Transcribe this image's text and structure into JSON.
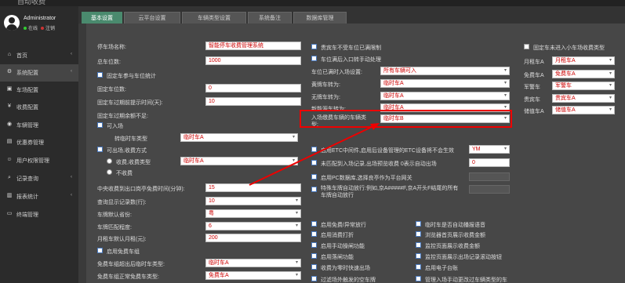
{
  "window": {
    "title": "自动收费"
  },
  "user": {
    "name": "Administrator",
    "online": "在线",
    "logout": "注销"
  },
  "nav": [
    {
      "icon": "home-icon",
      "glyph": "⌂",
      "label": "首页"
    },
    {
      "icon": "gear-icon",
      "glyph": "⚙",
      "label": "系统配置"
    },
    {
      "icon": "car-icon",
      "glyph": "▣",
      "label": "车场配置"
    },
    {
      "icon": "money-icon",
      "glyph": "¥",
      "label": "收费配置"
    },
    {
      "icon": "vehicle-icon",
      "glyph": "◉",
      "label": "车辆管理"
    },
    {
      "icon": "coupon-icon",
      "glyph": "▤",
      "label": "优惠券管理"
    },
    {
      "icon": "user-icon",
      "glyph": "☺",
      "label": "用户权限管理"
    },
    {
      "icon": "search-icon",
      "glyph": "⌕",
      "label": "记录查询"
    },
    {
      "icon": "report-icon",
      "glyph": "▥",
      "label": "报表统计"
    },
    {
      "icon": "terminal-icon",
      "glyph": "▭",
      "label": "终端管理"
    }
  ],
  "tabs": [
    "基本设置",
    "云平台设置",
    "车辆类型设置",
    "系统备注",
    "数据库管理"
  ],
  "left": {
    "park_name_label": "停车场名称:",
    "park_name": "智能停车收费管理系统",
    "total_spaces_label": "总车位数:",
    "total_spaces": "1000",
    "fixed_stats_label": "固定车参与车位统计",
    "fixed_spaces_label": "固定车位数:",
    "fixed_spaces": "0",
    "fixed_remind_label": "固定车过期前提示时间(天):",
    "fixed_remind": "10",
    "fixed_expired_label": "固定车过期余额不足:",
    "allow_in_label": "可入场",
    "convert_type_label": "转临时车类型",
    "convert_type": "临时车A",
    "allow_out_label": "可出场,收费方式",
    "charge_mode_label": "收费,收费类型",
    "charge_mode": "临时车A",
    "no_charge_label": "不收费",
    "free_minutes_label": "中央收费到出口岗亭免费时间(分钟):",
    "free_minutes": "15",
    "display_records_label": "查询显示记录数(行):",
    "display_records": "10",
    "plate_default_label": "车牌默认省份:",
    "plate_default": "粤",
    "plate_match_label": "车牌匹配程度:",
    "plate_match": "6",
    "monthly_price_label": "月租车默认月租(元):",
    "monthly_price": "200",
    "free_group_label": "启用免费车组",
    "free_group_over_label": "免费车组超出后临时车类型:",
    "free_group_over": "临时车A",
    "free_group_normal_label": "免费车组正常免费车类型:",
    "free_group_normal": "免费车A"
  },
  "middle": {
    "expensive_limit_label": "贵宾车不受车位已满限制",
    "full_manual_label": "车位满后入口转手动处理",
    "full_type_label": "车位已满时入场设置:",
    "full_type": "所有车辆可入",
    "yellow_label": "黄牌车转为:",
    "yellow": "临时车A",
    "noplate_label": "无牌车转为:",
    "noplate": "临时车A",
    "newenergy_label": "新能源车转为:",
    "newenergy": "临时车A",
    "entry_type_label": "入场缴费车辆的车辆类型:",
    "entry_type": "临时车B",
    "etc_label": "启用ETC中间件,启用后设备管理的ETC设备将不会生效",
    "etc_value": "YM",
    "unmatched_label": "未匹配到入场记录,出场预览收费 0表示自动出场",
    "unmatched_value": "0",
    "pc_label": "启用PC数据库,选择良亭作为平台网关",
    "special_label": "特殊车牌自动放行:例如,京A#####F,京A开头F结尾的所有车牌自动放行"
  },
  "right": {
    "fixed_unmatched_label": "固定车未进入小车场收费类型",
    "rows": [
      {
        "label": "月租车A",
        "value": "月租车A"
      },
      {
        "label": "免费车A",
        "value": "免费车A"
      },
      {
        "label": "军警车",
        "value": "军警车"
      },
      {
        "label": "贵宾车",
        "value": "贵宾车A"
      },
      {
        "label": "储值车A",
        "value": "储值车A"
      }
    ]
  },
  "bottom": {
    "left": [
      "启用免费/异常放行",
      "启用消费打折",
      "启用手动操闸功能",
      "启用落闸功能",
      "收费为零时快速出场",
      "过滤场外触发的空车牌"
    ],
    "right": [
      "临时车是否自动播报语音",
      "浏览器首页展示收费金额",
      "监控页面展示收费金额",
      "监控页面展示出场记录滚动按钮",
      "启用电子台账",
      "管理入场手动更改过车辆类型的车"
    ]
  }
}
